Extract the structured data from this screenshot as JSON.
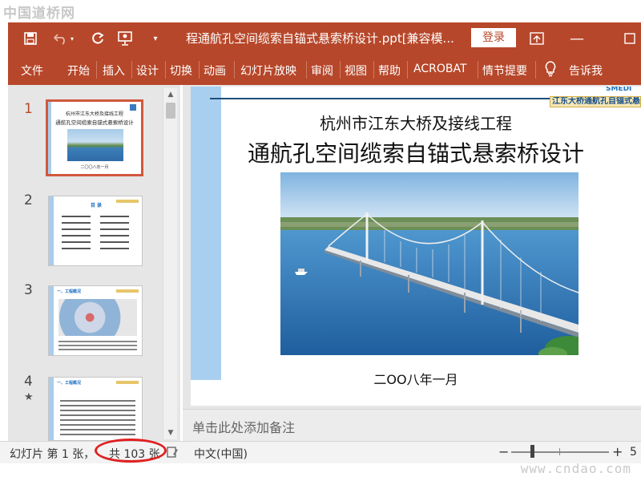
{
  "watermark": {
    "top": "中国道桥网",
    "bottom": "www.cndao.com"
  },
  "titlebar": {
    "title": "程通航孔空间缆索自锚式悬索桥设计.ppt[兼容模...",
    "login_label": "登录",
    "icons": [
      "save-icon",
      "undo-icon",
      "redo-icon",
      "presenter-icon",
      "customize-icon",
      "ribbon-display-icon",
      "restore-icon"
    ]
  },
  "ribbon": {
    "tabs": [
      "文件",
      "开始",
      "插入",
      "设计",
      "切换",
      "动画",
      "幻灯片放映",
      "审阅",
      "视图",
      "帮助",
      "ACROBAT",
      "情节提要"
    ],
    "tell_me": "告诉我"
  },
  "thumbnails": [
    {
      "number": "1",
      "active": true,
      "title_a": "杭州市江东大桥及接线工程",
      "title_b": "通航孔空间缆索自锚式悬索桥设计",
      "date": "二〇〇八年一月"
    },
    {
      "number": "2",
      "title": "目 录"
    },
    {
      "number": "3",
      "title": "一、工程概况"
    },
    {
      "number": "4",
      "title": "一、工程概况",
      "starred": true,
      "star": "★"
    }
  ],
  "slide": {
    "subtitle": "杭州市江东大桥及接线工程",
    "title": "通航孔空间缆索自锚式悬索桥设计",
    "date": "二OO八年一月",
    "logo": "SMEDI",
    "banner": "江东大桥通航孔自锚式悬索"
  },
  "notes": {
    "placeholder": "单击此处添加备注"
  },
  "status": {
    "slide_info_prefix": "幻灯片 第 1 张，",
    "slide_info_total": "共 103 张",
    "language": "中文(中国)",
    "zoom_minus": "−",
    "zoom_plus": "+",
    "zoom_value": "5"
  },
  "colors": {
    "accent": "#b7472a",
    "highlight": "#e02020"
  }
}
